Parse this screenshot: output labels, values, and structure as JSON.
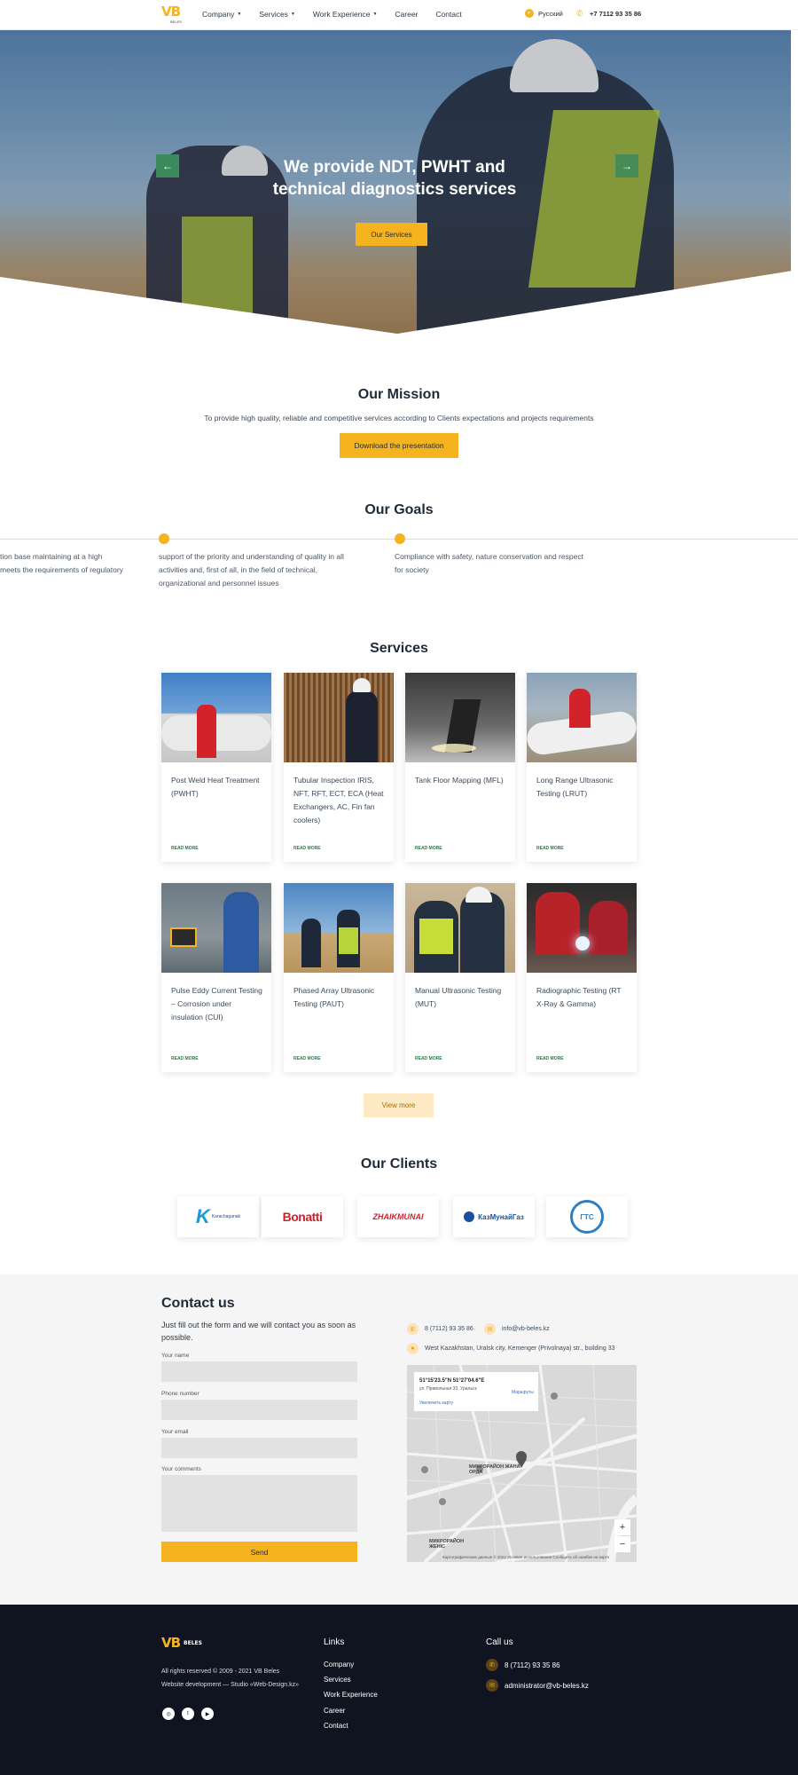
{
  "header": {
    "logo": {
      "vb": "VB",
      "sub": "BELES"
    },
    "nav": [
      {
        "label": "Company",
        "dropdown": true
      },
      {
        "label": "Services",
        "dropdown": true
      },
      {
        "label": "Work Experience",
        "dropdown": true
      },
      {
        "label": "Career",
        "dropdown": false
      },
      {
        "label": "Contact",
        "dropdown": false
      }
    ],
    "language": "Русский",
    "phone": "+7 7112 93 35 86"
  },
  "hero": {
    "title_line1": "We provide NDT, PWHT and",
    "title_line2": "technical diagnostics services",
    "button": "Our Services",
    "prev_icon": "arrow-left-icon",
    "next_icon": "arrow-right-icon"
  },
  "mission": {
    "title": "Our Mission",
    "text": "To provide high quality, reliable and competitive services according to Clients expectations and projects requirements",
    "button": "Download the presentation"
  },
  "goals": {
    "title": "Our Goals",
    "items": [
      {
        "line1": "tion base maintaining at a high",
        "line2": "meets the requirements of regulatory",
        "line3": ""
      },
      {
        "line1": "support of the priority and understanding of quality in all",
        "line2": "activities and, first of all, in the field of technical,",
        "line3": "organizational and personnel issues"
      },
      {
        "line1": "Compliance with safety, nature conservation and respect",
        "line2": "for society",
        "line3": ""
      }
    ]
  },
  "services": {
    "title": "Services",
    "read_more": "READ MORE",
    "view_more": "View more",
    "cards": [
      {
        "title": "Post Weld Heat Treatment (PWHT)"
      },
      {
        "title": "Tubular Inspection IRIS, NFT, RFT, ECT, ECA (Heat Exchangers, AC, Fin fan coolers)"
      },
      {
        "title": "Tank Floor Mapping (MFL)"
      },
      {
        "title": "Long Range Ultrasonic Testing (LRUT)"
      },
      {
        "title": "Pulse Eddy Current Testing – Corrosion under insulation (CUI)"
      },
      {
        "title": "Phased Array Ultrasonic Testing (PAUT)"
      },
      {
        "title": "Manual Ultrasonic Testing (MUT)"
      },
      {
        "title": "Radiographic Testing (RT X-Ray & Gamma)"
      }
    ]
  },
  "clients": {
    "title": "Our Clients",
    "logos": [
      {
        "name": "Karachaganak",
        "color": "#1a9ad6"
      },
      {
        "name": "Bonatti",
        "color": "#d11f2a"
      },
      {
        "name": "ZHAIKMUNAI",
        "color": "#d11f2a"
      },
      {
        "name": "КазМунайГаз",
        "color": "#1a4f9c"
      },
      {
        "name": "ГТС",
        "color": "#2d7fc2"
      }
    ]
  },
  "contact": {
    "title": "Contact us",
    "subtitle": "Just fill out the form and we will contact you as soon as possible.",
    "fields": {
      "name": "Your name",
      "phone": "Phone number",
      "email": "Your email",
      "comments": "Your comments"
    },
    "send": "Send",
    "phone": "8 (7112) 93 35 86",
    "email": "info@vb-beles.kz",
    "address": "West Kazakhstan, Uralsk city, Kemenger (Privolnaya) str., building 33",
    "map": {
      "coords": "51°15'23.5\"N 51°27'04.6\"E",
      "address": "ул. Привольная 33, Уральск",
      "enlarge": "Увеличить карту",
      "routes": "Маршруты",
      "district1": "МИКРОРАЙОН ЖАНА ОРДА",
      "district2": "МИКРОРАЙОН ЖЕНІС",
      "footer": "Картографические данные © 2022   Условия использования   Сообщить об ошибке на карте",
      "zoom_in": "+",
      "zoom_out": "−"
    }
  },
  "footer": {
    "logo": "VB",
    "logo_sub": "BELES",
    "rights": "All rights reserved © 2009 - 2021 VB Beles",
    "dev": "Website development — Studio «Web-Design.kz»",
    "social": [
      "instagram-icon",
      "twitter-icon",
      "youtube-icon"
    ],
    "links_title": "Links",
    "links": [
      "Company",
      "Services",
      "Work Experience",
      "Career",
      "Contact"
    ],
    "call_title": "Call us",
    "phone": "8 (7112) 93 35 86",
    "email": "administrator@vb-beles.kz"
  },
  "colors": {
    "accent": "#f5b41f",
    "brand_green": "#2a7a4a",
    "footer_bg": "#0f1420",
    "contact_bg": "#f5f5f5"
  }
}
